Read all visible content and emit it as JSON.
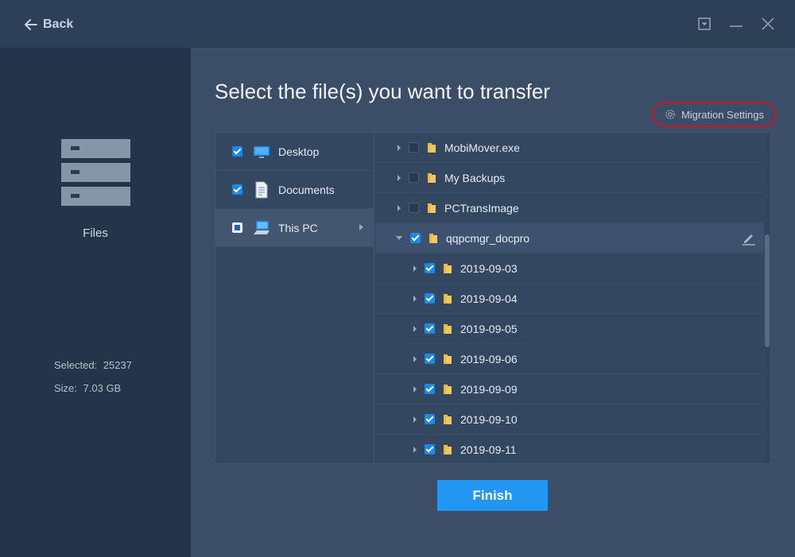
{
  "titlebar": {
    "back_label": "Back",
    "icons": {
      "back": "arrow-left-icon",
      "dropdown": "dropdown-box-icon",
      "minimize": "minimize-icon",
      "close": "close-icon"
    }
  },
  "sidebar": {
    "section_label": "Files",
    "section_icon": "files-stack-icon",
    "selected_label": "Selected:",
    "selected_value": "25237",
    "size_label": "Size:",
    "size_value": "7.03 GB"
  },
  "main": {
    "title": "Select the file(s) you want to transfer",
    "migration_settings_label": "Migration Settings",
    "finish_label": "Finish"
  },
  "locations": [
    {
      "label": "Desktop",
      "state": "checked",
      "icon": "desktop-monitor-icon"
    },
    {
      "label": "Documents",
      "state": "checked",
      "icon": "document-icon"
    },
    {
      "label": "This PC",
      "state": "partial",
      "icon": "computer-icon",
      "active": true
    }
  ],
  "tree": [
    {
      "name": "MobiMover.exe",
      "level": 0,
      "state": "unchecked",
      "expanded": false
    },
    {
      "name": "My Backups",
      "level": 0,
      "state": "unchecked",
      "expanded": false
    },
    {
      "name": "PCTransImage",
      "level": 0,
      "state": "unchecked",
      "expanded": false
    },
    {
      "name": "qqpcmgr_docpro",
      "level": 0,
      "state": "checked",
      "expanded": true,
      "highlight": true
    },
    {
      "name": "2019-09-03",
      "level": 1,
      "state": "checked",
      "expanded": false
    },
    {
      "name": "2019-09-04",
      "level": 1,
      "state": "checked",
      "expanded": false
    },
    {
      "name": "2019-09-05",
      "level": 1,
      "state": "checked",
      "expanded": false
    },
    {
      "name": "2019-09-06",
      "level": 1,
      "state": "checked",
      "expanded": false
    },
    {
      "name": "2019-09-09",
      "level": 1,
      "state": "checked",
      "expanded": false
    },
    {
      "name": "2019-09-10",
      "level": 1,
      "state": "checked",
      "expanded": false
    },
    {
      "name": "2019-09-11",
      "level": 1,
      "state": "checked",
      "expanded": false
    }
  ],
  "colors": {
    "accent": "#2196f3",
    "checkbox": "#1e88e5",
    "highlight_ring": "#c41a2a",
    "folder": "#f5c75a"
  }
}
